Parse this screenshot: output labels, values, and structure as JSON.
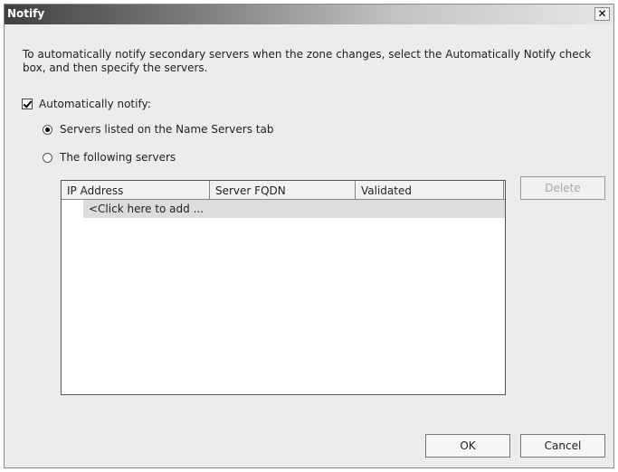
{
  "window": {
    "title": "Notify",
    "close_glyph": "✕"
  },
  "description": "To automatically notify secondary servers when the zone changes, select the Automatically Notify check box, and then specify the servers.",
  "auto_notify": {
    "label": "Automatically notify:",
    "checked": true
  },
  "options": [
    {
      "label": "Servers listed on the Name Servers tab",
      "selected": true
    },
    {
      "label": "The following servers",
      "selected": false
    }
  ],
  "table": {
    "columns": [
      "IP Address",
      "Server FQDN",
      "Validated"
    ],
    "add_placeholder": "<Click here to add ..."
  },
  "buttons": {
    "delete": "Delete",
    "ok": "OK",
    "cancel": "Cancel"
  }
}
